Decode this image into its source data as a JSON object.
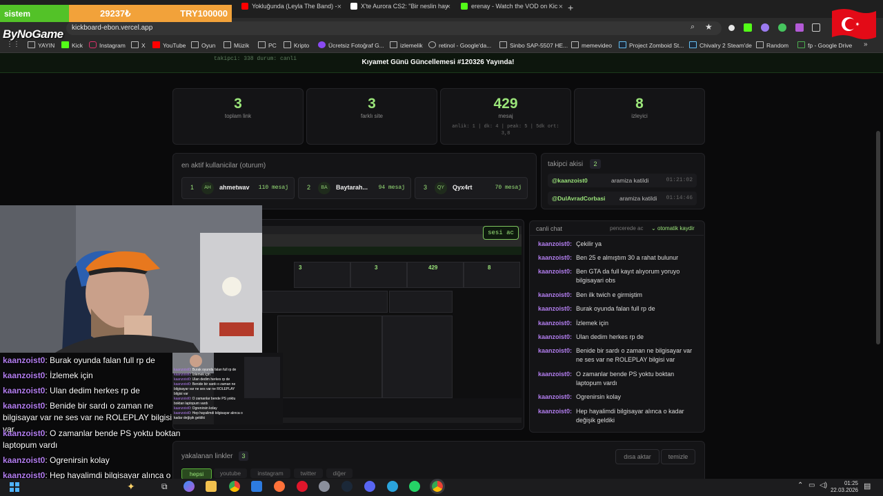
{
  "browser": {
    "tabs": [
      {
        "label": "Yokluğunda (Leyla The Band) -",
        "icon": "youtube-icon",
        "color": "#ff0000"
      },
      {
        "label": "X'te Aurora CS2: \"Bir neslin hay",
        "icon": "x-icon",
        "color": "#ffffff"
      },
      {
        "label": "erenay - Watch the VOD on Kic",
        "icon": "kick-icon",
        "color": "#53fc18"
      }
    ],
    "url": "kickboard-ebon.vercel.app",
    "bookmarks": [
      "YAYIN",
      "Kick",
      "Instagram",
      "X",
      "YouTube",
      "Oyun",
      "Müzik",
      "PC",
      "Kripto",
      "Ücretsiz Fotoğraf G...",
      "izlemelik",
      "retinol - Google'da...",
      "Sinbo SAP-5507 HE...",
      "memevideo",
      "Project Zomboid St...",
      "Chivalry 2 Steam'de",
      "Random",
      "fp - Google Drive"
    ]
  },
  "overlay": {
    "sistem": "sistem",
    "points": "29237₺",
    "goal": "TRY100000",
    "brand": "ByNoGame"
  },
  "dashboard": {
    "banner_faded": "takipci: 338  durum: canli",
    "banner": "Kıyamet Günü Güncellemesi #120326 Yayında!",
    "stats": [
      {
        "value": "3",
        "label": "toplam link",
        "sub": ""
      },
      {
        "value": "3",
        "label": "farklı site",
        "sub": ""
      },
      {
        "value": "429",
        "label": "mesaj",
        "sub": "anlik: 1 | dk: 4 | peak: 5 | 5dk ort: 3,8"
      },
      {
        "value": "8",
        "label": "izleyici",
        "sub": ""
      }
    ],
    "active_users_title": "en aktif kullanicilar (oturum)",
    "active_users": [
      {
        "rank": "1",
        "initials": "AH",
        "name": "ahmetwav",
        "count": "110 mesaj"
      },
      {
        "rank": "2",
        "initials": "BA",
        "name": "Baytarah...",
        "count": "94 mesaj"
      },
      {
        "rank": "3",
        "initials": "QY",
        "name": "Qyx4rt",
        "count": "70 mesaj"
      }
    ],
    "follower_flow_title": "takipci akisi",
    "follower_count": "2",
    "followers": [
      {
        "user": "@kaanzoist0",
        "action": "aramiza katildi",
        "time": "01:21:02"
      },
      {
        "user": "@DulAvradCorbasi",
        "action": "aramiza katildi",
        "time": "01:14:46"
      }
    ],
    "sound_button": "sesi ac",
    "live_chat_title": "canli chat",
    "popout": "pencerede ac",
    "autoscroll": "otomatik kaydir",
    "chat": [
      {
        "user": "kaanzoist0:",
        "text": "Çekilir ya"
      },
      {
        "user": "kaanzoist0:",
        "text": "Ben 25 e almıştım 30 a rahat bulunur"
      },
      {
        "user": "kaanzoist0:",
        "text": "Ben GTA da full kayıt alıyorum yoruyo bilgisayari obs"
      },
      {
        "user": "kaanzoist0:",
        "text": "Ben ilk twich e girmiştim"
      },
      {
        "user": "kaanzoist0:",
        "text": "Burak oyunda falan full rp de"
      },
      {
        "user": "kaanzoist0:",
        "text": "İzlemek için"
      },
      {
        "user": "kaanzoist0:",
        "text": "Ulan dedim herkes rp de"
      },
      {
        "user": "kaanzoist0:",
        "text": "Benide bir sardı o zaman ne bilgisayar var ne ses var ne ROLEPLAY bilgisi var"
      },
      {
        "user": "kaanzoist0:",
        "text": "O zamanlar bende PS yoktu boktan laptopum vardı"
      },
      {
        "user": "kaanzoist0:",
        "text": "Ogrenirsin kolay"
      },
      {
        "user": "kaanzoist0:",
        "text": "Hep hayalimdi bilgisayar alınca o kadar değişik geldiki"
      }
    ],
    "links_title": "yakalanan linkler",
    "links_count": "3",
    "expand": "dısa aktar",
    "clear": "temizle",
    "filters": [
      "hepsi",
      "youtube",
      "instagram",
      "twitter",
      "diğer"
    ]
  },
  "stream_chat": [
    {
      "user": "kaanzoist0",
      "text": ": Burak oyunda falan full rp de"
    },
    {
      "user": "kaanzoist0",
      "text": ": İzlemek için"
    },
    {
      "user": "kaanzoist0",
      "text": ": Ulan dedim herkes rp de"
    },
    {
      "user": "kaanzoist0",
      "text": ": Benide bir sardı o zaman ne bilgisayar var ne ses var ne ROLEPLAY bilgisi var"
    },
    {
      "user": "kaanzoist0",
      "text": ": O zamanlar bende PS yoktu boktan laptopum vardı"
    },
    {
      "user": "kaanzoist0",
      "text": ": Ogrenirsin kolay"
    },
    {
      "user": "kaanzoist0",
      "text": ": Hep hayalimdi bilgisayar alınca o kadar değişik geldiki"
    }
  ],
  "taskbar": {
    "time": "01:25",
    "date": "22.03.2026"
  },
  "colors": {
    "accent_green": "#9be57a",
    "username_purple": "#b37ef0",
    "sistem_green": "#53c228",
    "goal_orange": "#f2a23a"
  }
}
